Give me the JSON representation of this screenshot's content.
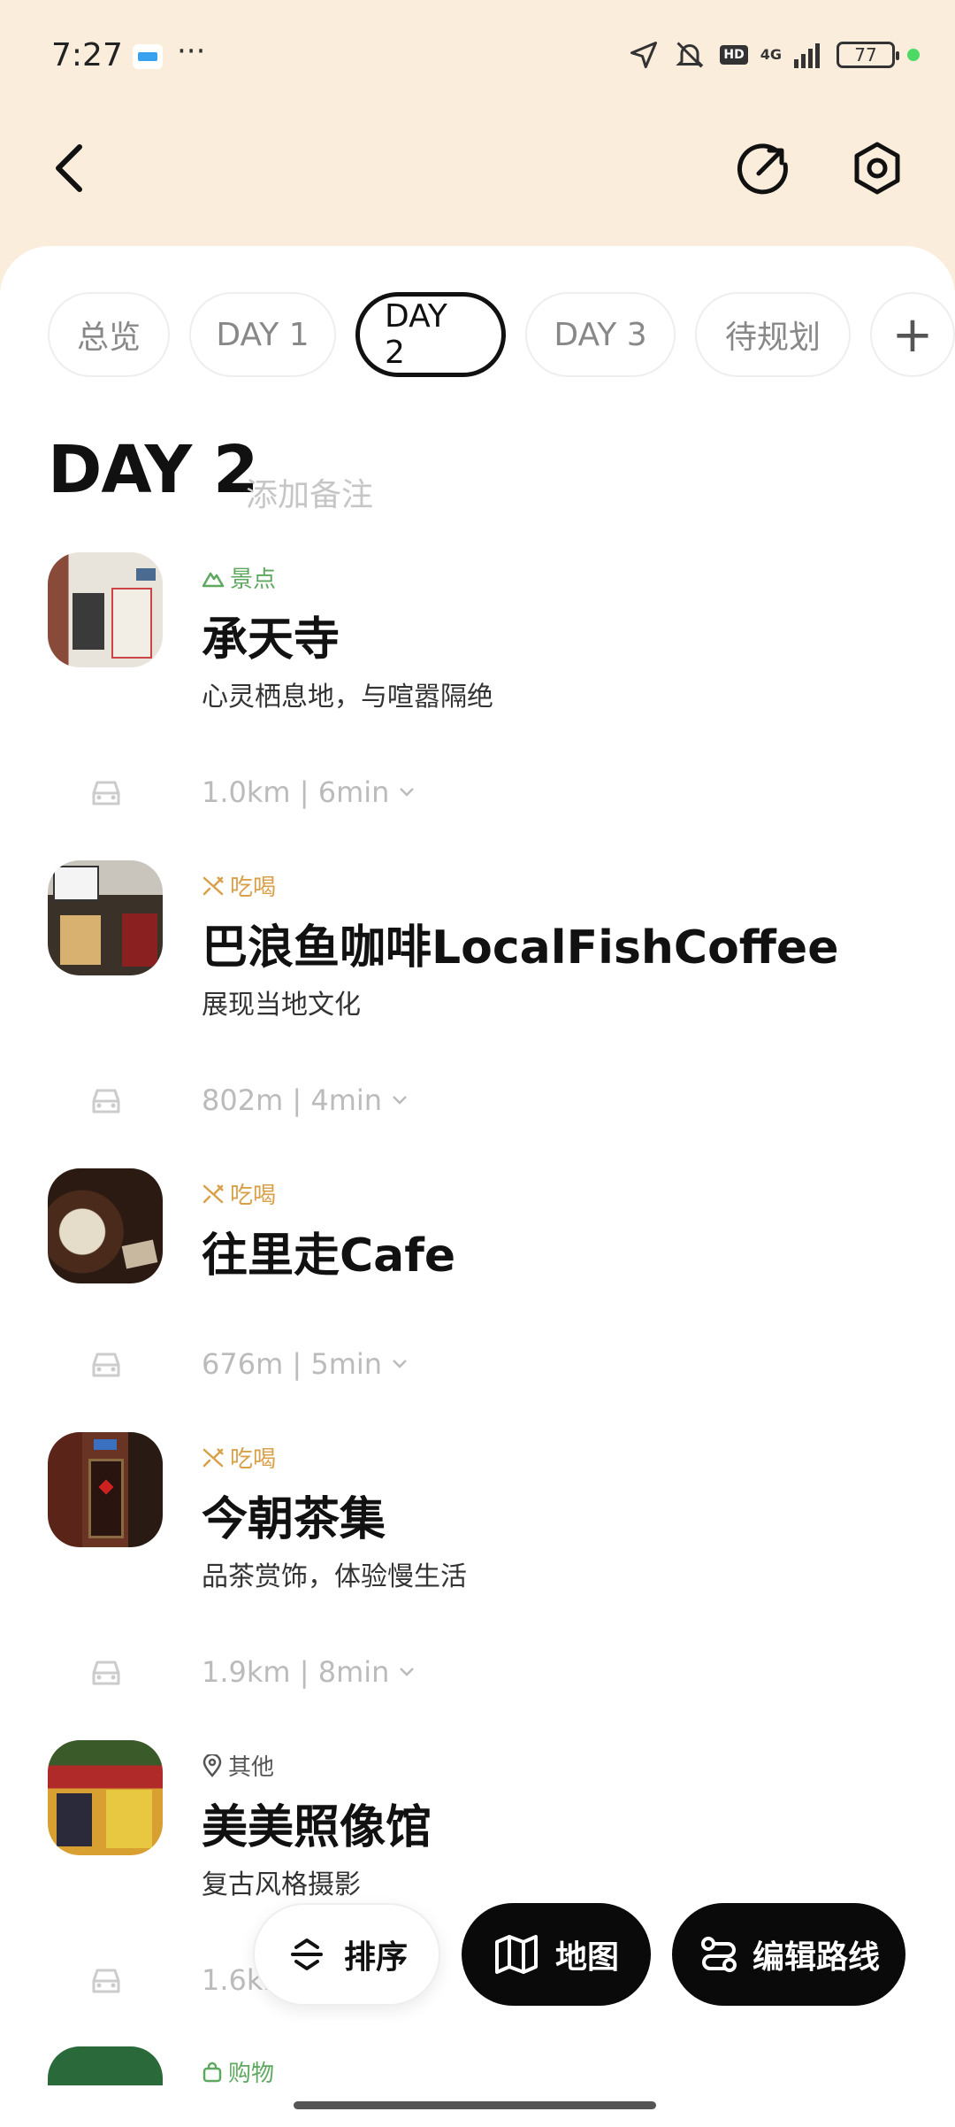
{
  "status_bar": {
    "time": "7:27",
    "dots": "···",
    "battery": "77",
    "network": "4G",
    "hd": "HD"
  },
  "tabs": [
    {
      "label": "总览",
      "active": false
    },
    {
      "label": "DAY 1",
      "active": false
    },
    {
      "label": "DAY 2",
      "active": true
    },
    {
      "label": "DAY 3",
      "active": false
    },
    {
      "label": "待规划",
      "active": false
    },
    {
      "label": "+",
      "active": false
    }
  ],
  "heading": {
    "title": "DAY 2",
    "note_placeholder": "添加备注"
  },
  "places": [
    {
      "category": "景点",
      "category_icon": "mountain-icon",
      "category_color": "#5fa85f",
      "name": "承天寺",
      "desc": "心灵栖息地，与喧嚣隔绝"
    },
    {
      "category": "吃喝",
      "category_icon": "utensils-icon",
      "category_color": "#d9a04a",
      "name": "巴浪鱼咖啡LocalFishCoffee",
      "desc": "展现当地文化"
    },
    {
      "category": "吃喝",
      "category_icon": "utensils-icon",
      "category_color": "#d9a04a",
      "name": "往里走Cafe",
      "desc": ""
    },
    {
      "category": "吃喝",
      "category_icon": "utensils-icon",
      "category_color": "#d9a04a",
      "name": "今朝茶集",
      "desc": "品茶赏饰，体验慢生活"
    },
    {
      "category": "其他",
      "category_icon": "location-pin-icon",
      "category_color": "#555555",
      "name": "美美照像馆",
      "desc": "复古风格摄影"
    },
    {
      "category": "购物",
      "category_icon": "shopping-bag-icon",
      "category_color": "#5fa85f",
      "name": "",
      "desc": ""
    }
  ],
  "routes": [
    {
      "text": "1.0km | 6min"
    },
    {
      "text": "802m | 4min"
    },
    {
      "text": "676m | 5min"
    },
    {
      "text": "1.9km | 8min"
    },
    {
      "text": "1.6km"
    }
  ],
  "actions": {
    "sort": "排序",
    "map": "地图",
    "edit_route": "编辑路线"
  },
  "colors": {
    "header_bg": "#fbeddc",
    "accent_dark": "#0a0a0a",
    "food": "#d9a04a",
    "sight": "#5fa85f"
  }
}
